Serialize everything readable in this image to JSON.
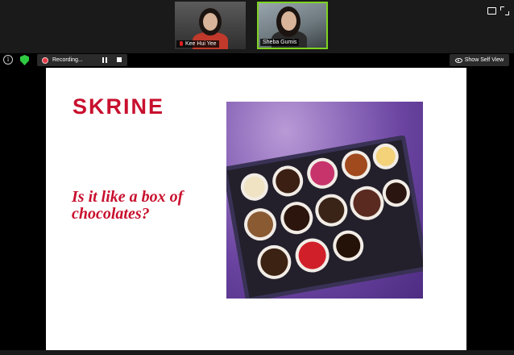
{
  "participants": [
    {
      "name": "Kee Hui Yee",
      "muted": true
    },
    {
      "name": "Sheba Gumis",
      "muted": false,
      "active_speaker": true
    }
  ],
  "status": {
    "recording_label": "Recording...",
    "self_view_label": "Show Self View"
  },
  "slide": {
    "brand": "SKRINE",
    "question": "Is it like a box of chocolates?",
    "brand_color": "#c8102e"
  },
  "colors": {
    "active_speaker_border": "#7ed321",
    "recording_dot": "#e63946",
    "security_shield": "#2ecc40"
  }
}
